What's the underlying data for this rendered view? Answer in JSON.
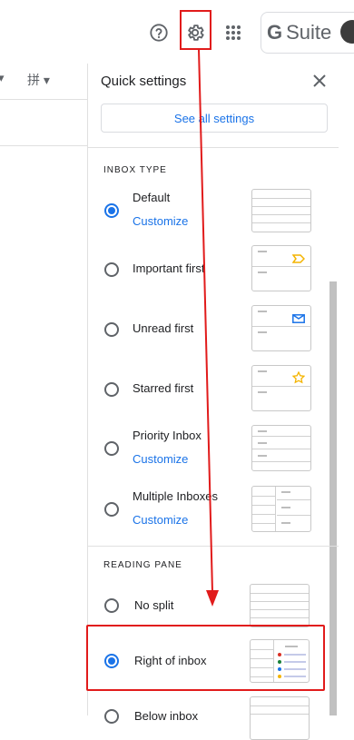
{
  "topbar": {
    "help_icon": "help-circle-icon",
    "settings_icon": "gear-icon",
    "apps_icon": "apps-grid-icon",
    "gsuite_g": "G",
    "gsuite_label": "Suite"
  },
  "left": {
    "chevron_label": "▾",
    "pin_label": "拼 ▾"
  },
  "quick_settings": {
    "title": "Quick settings",
    "close_icon": "close-icon",
    "see_all": "See all settings",
    "inbox_type": {
      "heading": "INBOX TYPE",
      "options": [
        {
          "label": "Default",
          "customize": "Customize",
          "selected": true,
          "thumb": "plain"
        },
        {
          "label": "Important first",
          "customize": "",
          "selected": false,
          "thumb": "important"
        },
        {
          "label": "Unread first",
          "customize": "",
          "selected": false,
          "thumb": "unread"
        },
        {
          "label": "Starred first",
          "customize": "",
          "selected": false,
          "thumb": "starred"
        },
        {
          "label": "Priority Inbox",
          "customize": "Customize",
          "selected": false,
          "thumb": "priority"
        },
        {
          "label": "Multiple Inboxes",
          "customize": "Customize",
          "selected": false,
          "thumb": "multiple"
        }
      ]
    },
    "reading_pane": {
      "heading": "READING PANE",
      "options": [
        {
          "label": "No split",
          "selected": false
        },
        {
          "label": "Right of inbox",
          "selected": true
        },
        {
          "label": "Below inbox",
          "selected": false
        }
      ]
    }
  },
  "colors": {
    "accent": "#1a73e8",
    "annotation_red": "#e11b1b",
    "important_icon": "#f4b400",
    "unread_icon": "#1a73e8",
    "star_icon": "#f4b400"
  }
}
